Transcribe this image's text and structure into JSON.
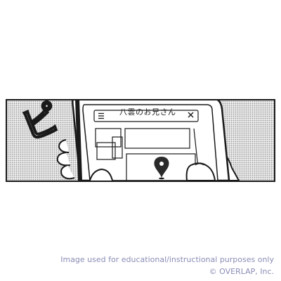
{
  "panel": {
    "sound_effect": "ピ",
    "phone_screen": {
      "menu_icon": "hamburger-icon",
      "search_text": "八雲のお兄さん",
      "close_glyph": "×",
      "map_pin_icon": "map-pin-icon"
    }
  },
  "credits": {
    "line1": "Image used for educational/instructional purposes only",
    "line2": "© OVERLAP, Inc."
  },
  "colors": {
    "ink": "#1a1a1a",
    "screentone": "#e9e9e9",
    "credit_text": "#8a8db5"
  }
}
